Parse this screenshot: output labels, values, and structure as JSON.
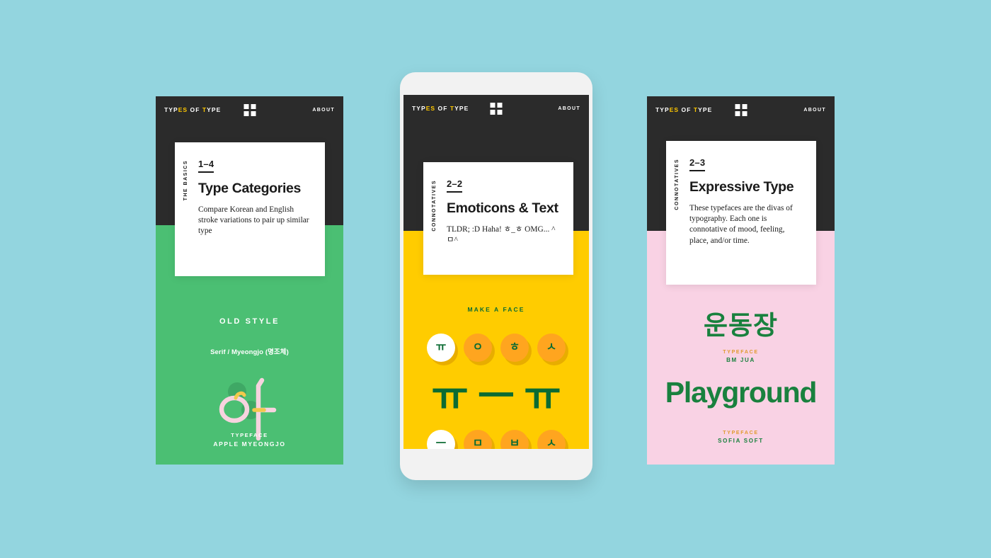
{
  "background_color": "#93D5DF",
  "colors": {
    "dark": "#2B2B2B",
    "accent_yellow": "#FFC800",
    "green_panel": "#4BBF73",
    "yellow_panel": "#FFCC00",
    "pink_panel": "#F9D2E4",
    "dark_green": "#0B6B33",
    "key_orange": "#FFA51F",
    "gold_label": "#E09A2E"
  },
  "header": {
    "logo_parts": [
      {
        "text": "TYP",
        "highlight": false
      },
      {
        "text": "ES",
        "highlight": true
      },
      {
        "text": " OF ",
        "highlight": false
      },
      {
        "text": "T",
        "highlight": true
      },
      {
        "text": "YPE",
        "highlight": false
      }
    ],
    "logo_plain": "TYPES OF TYPE",
    "grid_icon": "grid-2x2-icon",
    "about_label": "ABOUT"
  },
  "phones": [
    {
      "id": "phone-1",
      "card": {
        "side_label": "THE BASICS",
        "number": "1–4",
        "title": "Type Categories",
        "description": "Compare Korean and English stroke variations to pair up similar type"
      },
      "panel": {
        "kicker": "OLD STYLE",
        "subtitle": "Serif / Myeongjo (명조체)",
        "specimen_glyph": "아",
        "typeface_label": "TYPEFACE",
        "typeface_name": "APPLE MYEONGJO"
      }
    },
    {
      "id": "phone-2",
      "card": {
        "side_label": "CONNOTATIVES",
        "number": "2–2",
        "title": "Emoticons & Text",
        "description": "TLDR; :D Haha! ㅎ_ㅎ OMG... ^ㅁ^"
      },
      "panel": {
        "kicker": "MAKE A FACE",
        "keys_top": [
          {
            "glyph": "ㅠ",
            "selected": true
          },
          {
            "glyph": "ㅇ",
            "selected": false
          },
          {
            "glyph": "ㅎ",
            "selected": false
          },
          {
            "glyph": "ㅅ",
            "selected": false
          }
        ],
        "keys_bottom": [
          {
            "glyph": "ㅡ",
            "selected": true
          },
          {
            "glyph": "ㅁ",
            "selected": false
          },
          {
            "glyph": "ㅂ",
            "selected": false
          },
          {
            "glyph": "ㅅ",
            "selected": false
          }
        ],
        "face_parts": [
          "ㅠ",
          "ㅡ",
          "ㅠ"
        ]
      }
    },
    {
      "id": "phone-3",
      "card": {
        "side_label": "CONNOTATIVES",
        "number": "2–3",
        "title": "Expressive Type",
        "description": "These typefaces are the divas of typography. Each one is connotative of mood, feeling, place, and/or time."
      },
      "panel": {
        "hangul_specimen": "운동장",
        "typeface_label_1": "TYPEFACE",
        "typeface_name_1": "BM JUA",
        "latin_specimen": "Playground",
        "typeface_label_2": "TYPEFACE",
        "typeface_name_2": "SOFIA SOFT"
      }
    }
  ]
}
